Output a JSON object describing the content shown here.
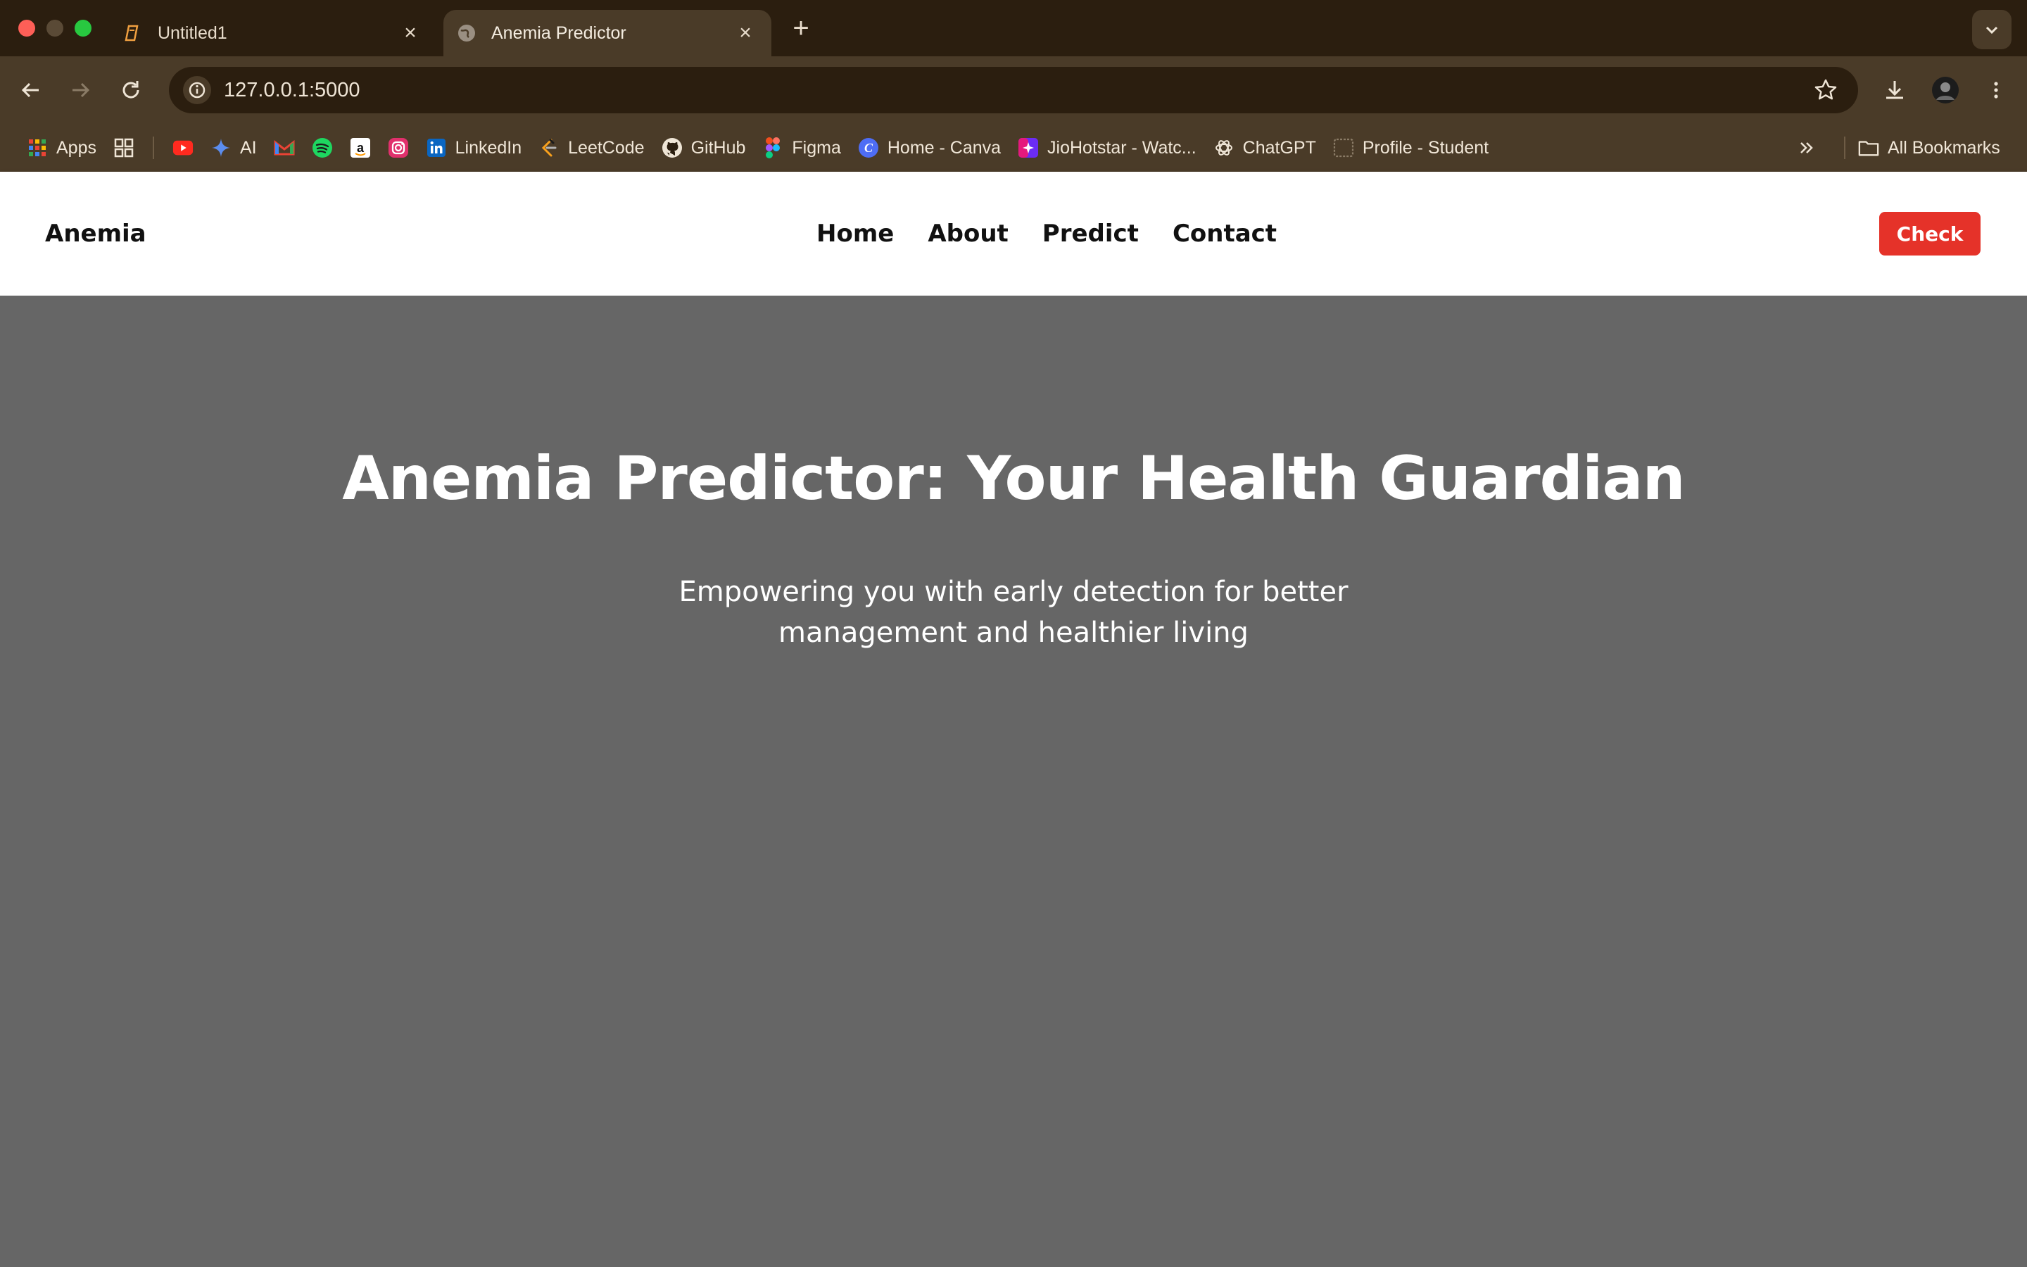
{
  "browser": {
    "tabs": [
      {
        "title": "Untitled1",
        "icon": "document-icon",
        "active": false
      },
      {
        "title": "Anemia Predictor",
        "icon": "globe-icon",
        "active": true
      }
    ],
    "address": "127.0.0.1:5000",
    "bookmarks": [
      {
        "label": "Apps",
        "icon": "apps-grid-icon"
      },
      {
        "label": "",
        "icon": "tab-groups-icon"
      },
      {
        "label": "",
        "icon": "youtube-icon"
      },
      {
        "label": "AI",
        "icon": "gemini-sparkle-icon"
      },
      {
        "label": "",
        "icon": "gmail-icon"
      },
      {
        "label": "",
        "icon": "spotify-icon"
      },
      {
        "label": "",
        "icon": "amazon-icon"
      },
      {
        "label": "",
        "icon": "instagram-icon"
      },
      {
        "label": "LinkedIn",
        "icon": "linkedin-icon"
      },
      {
        "label": "LeetCode",
        "icon": "leetcode-icon"
      },
      {
        "label": "GitHub",
        "icon": "github-icon"
      },
      {
        "label": "Figma",
        "icon": "figma-icon"
      },
      {
        "label": "Home - Canva",
        "icon": "canva-icon"
      },
      {
        "label": "JioHotstar - Watc...",
        "icon": "hotstar-icon"
      },
      {
        "label": "ChatGPT",
        "icon": "chatgpt-icon"
      },
      {
        "label": "Profile - Student",
        "icon": "profile-page-icon"
      }
    ],
    "all_bookmarks": "All Bookmarks",
    "colors": {
      "tabbar": "#2b1e0f",
      "toolbar": "#4a3b28"
    }
  },
  "site": {
    "brand": "Anemia",
    "nav": [
      "Home",
      "About",
      "Predict",
      "Contact"
    ],
    "cta": "Check",
    "hero": {
      "title": "Anemia Predictor: Your Health Guardian",
      "subtitle": "Empowering you with early detection for better management and healthier living"
    },
    "colors": {
      "accent": "#e53229",
      "hero_bg": "#666666",
      "nav_bg": "#ffffff"
    }
  }
}
